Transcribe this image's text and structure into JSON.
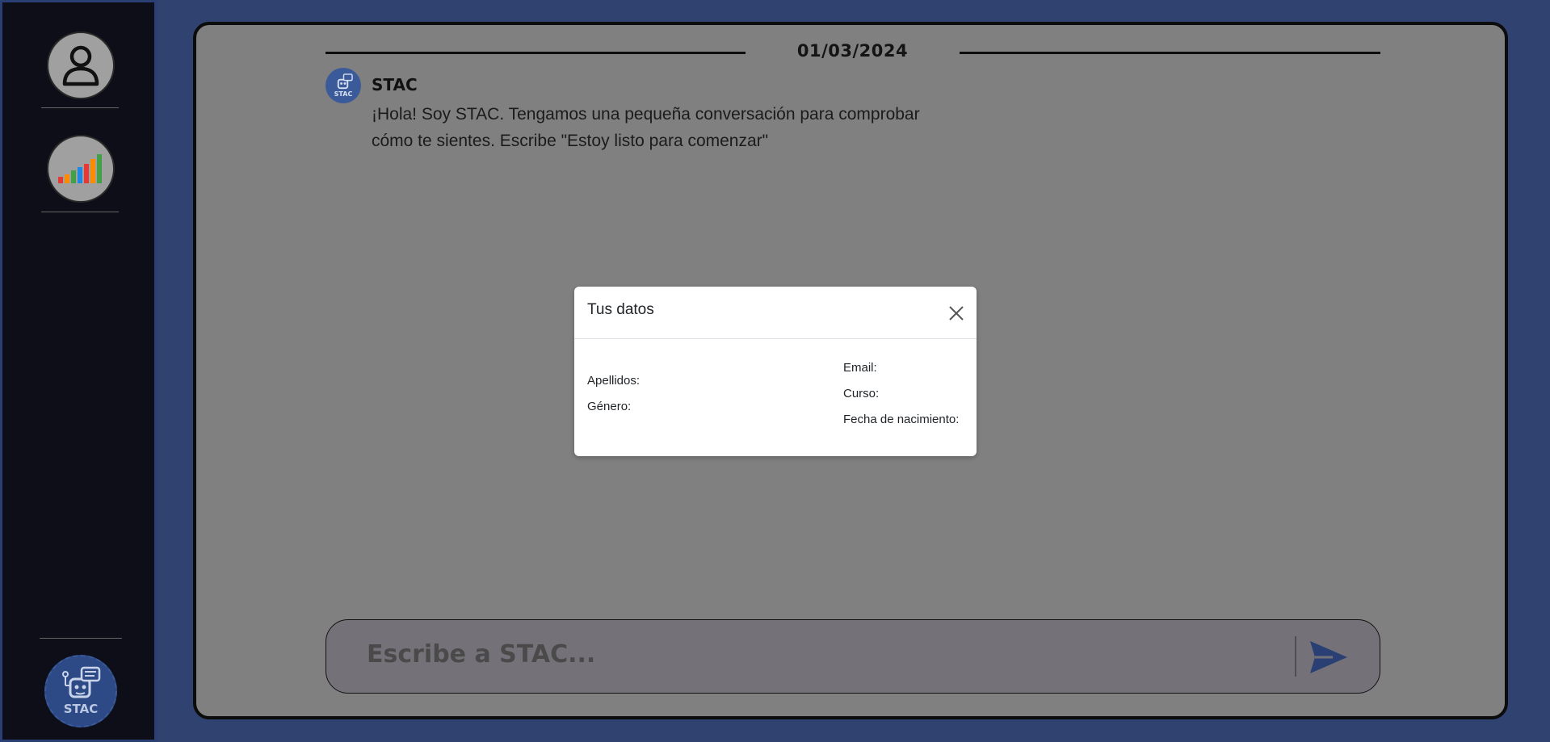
{
  "sidebar": {
    "profile_icon": "user-icon",
    "stats_icon": "bar-chart-icon",
    "logo_label": "STAC"
  },
  "chat": {
    "date": "01/03/2024",
    "sender": "STAC",
    "avatar_label": "STAC",
    "message": "¡Hola! Soy STAC. Tengamos una pequeña conversación para comprobar cómo te sientes. Escribe \"Estoy listo para comenzar\"",
    "input_placeholder": "Escribe a STAC...",
    "send_icon": "send-icon"
  },
  "modal": {
    "title": "Tus datos",
    "close_icon": "close-icon",
    "fields": {
      "apellidos": "Apellidos:",
      "genero": "Género:",
      "email": "Email:",
      "curso": "Curso:",
      "fecha": "Fecha de nacimiento:"
    }
  },
  "colors": {
    "sidebar_bg": "#0d0e18",
    "main_bg": "#2f4270",
    "panel_bg": "#808080",
    "accent": "#2d4a86"
  }
}
